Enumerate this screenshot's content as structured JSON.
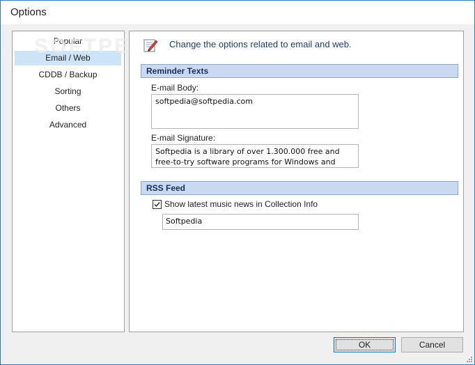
{
  "window": {
    "title": "Options",
    "watermark": "SOFTPEDIA"
  },
  "nav": {
    "items": [
      {
        "label": "Popular"
      },
      {
        "label": "Email / Web"
      },
      {
        "label": "CDDB / Backup"
      },
      {
        "label": "Sorting"
      },
      {
        "label": "Others"
      },
      {
        "label": "Advanced"
      }
    ],
    "selected": "Email / Web"
  },
  "header": {
    "text": "Change the options related to email and web.",
    "icon": "email-web-options-icon"
  },
  "reminder": {
    "title": "Reminder Texts",
    "email_body_label": "E-mail Body:",
    "email_body_value": "softpedia@softpedia.com",
    "email_signature_label": "E-mail Signature:",
    "email_signature_value": "Softpedia is a library of over 1.300.000 free and\nfree-to-try software programs for Windows and"
  },
  "rss": {
    "title": "RSS Feed",
    "checkbox_label": "Show latest music news in Collection Info",
    "checked": true,
    "feed_value": "Softpedia"
  },
  "buttons": {
    "ok": "OK",
    "cancel": "Cancel"
  },
  "colors": {
    "selection": "#cce4f7",
    "section_bar": "#c9d9f1",
    "accent": "#0078d7"
  }
}
